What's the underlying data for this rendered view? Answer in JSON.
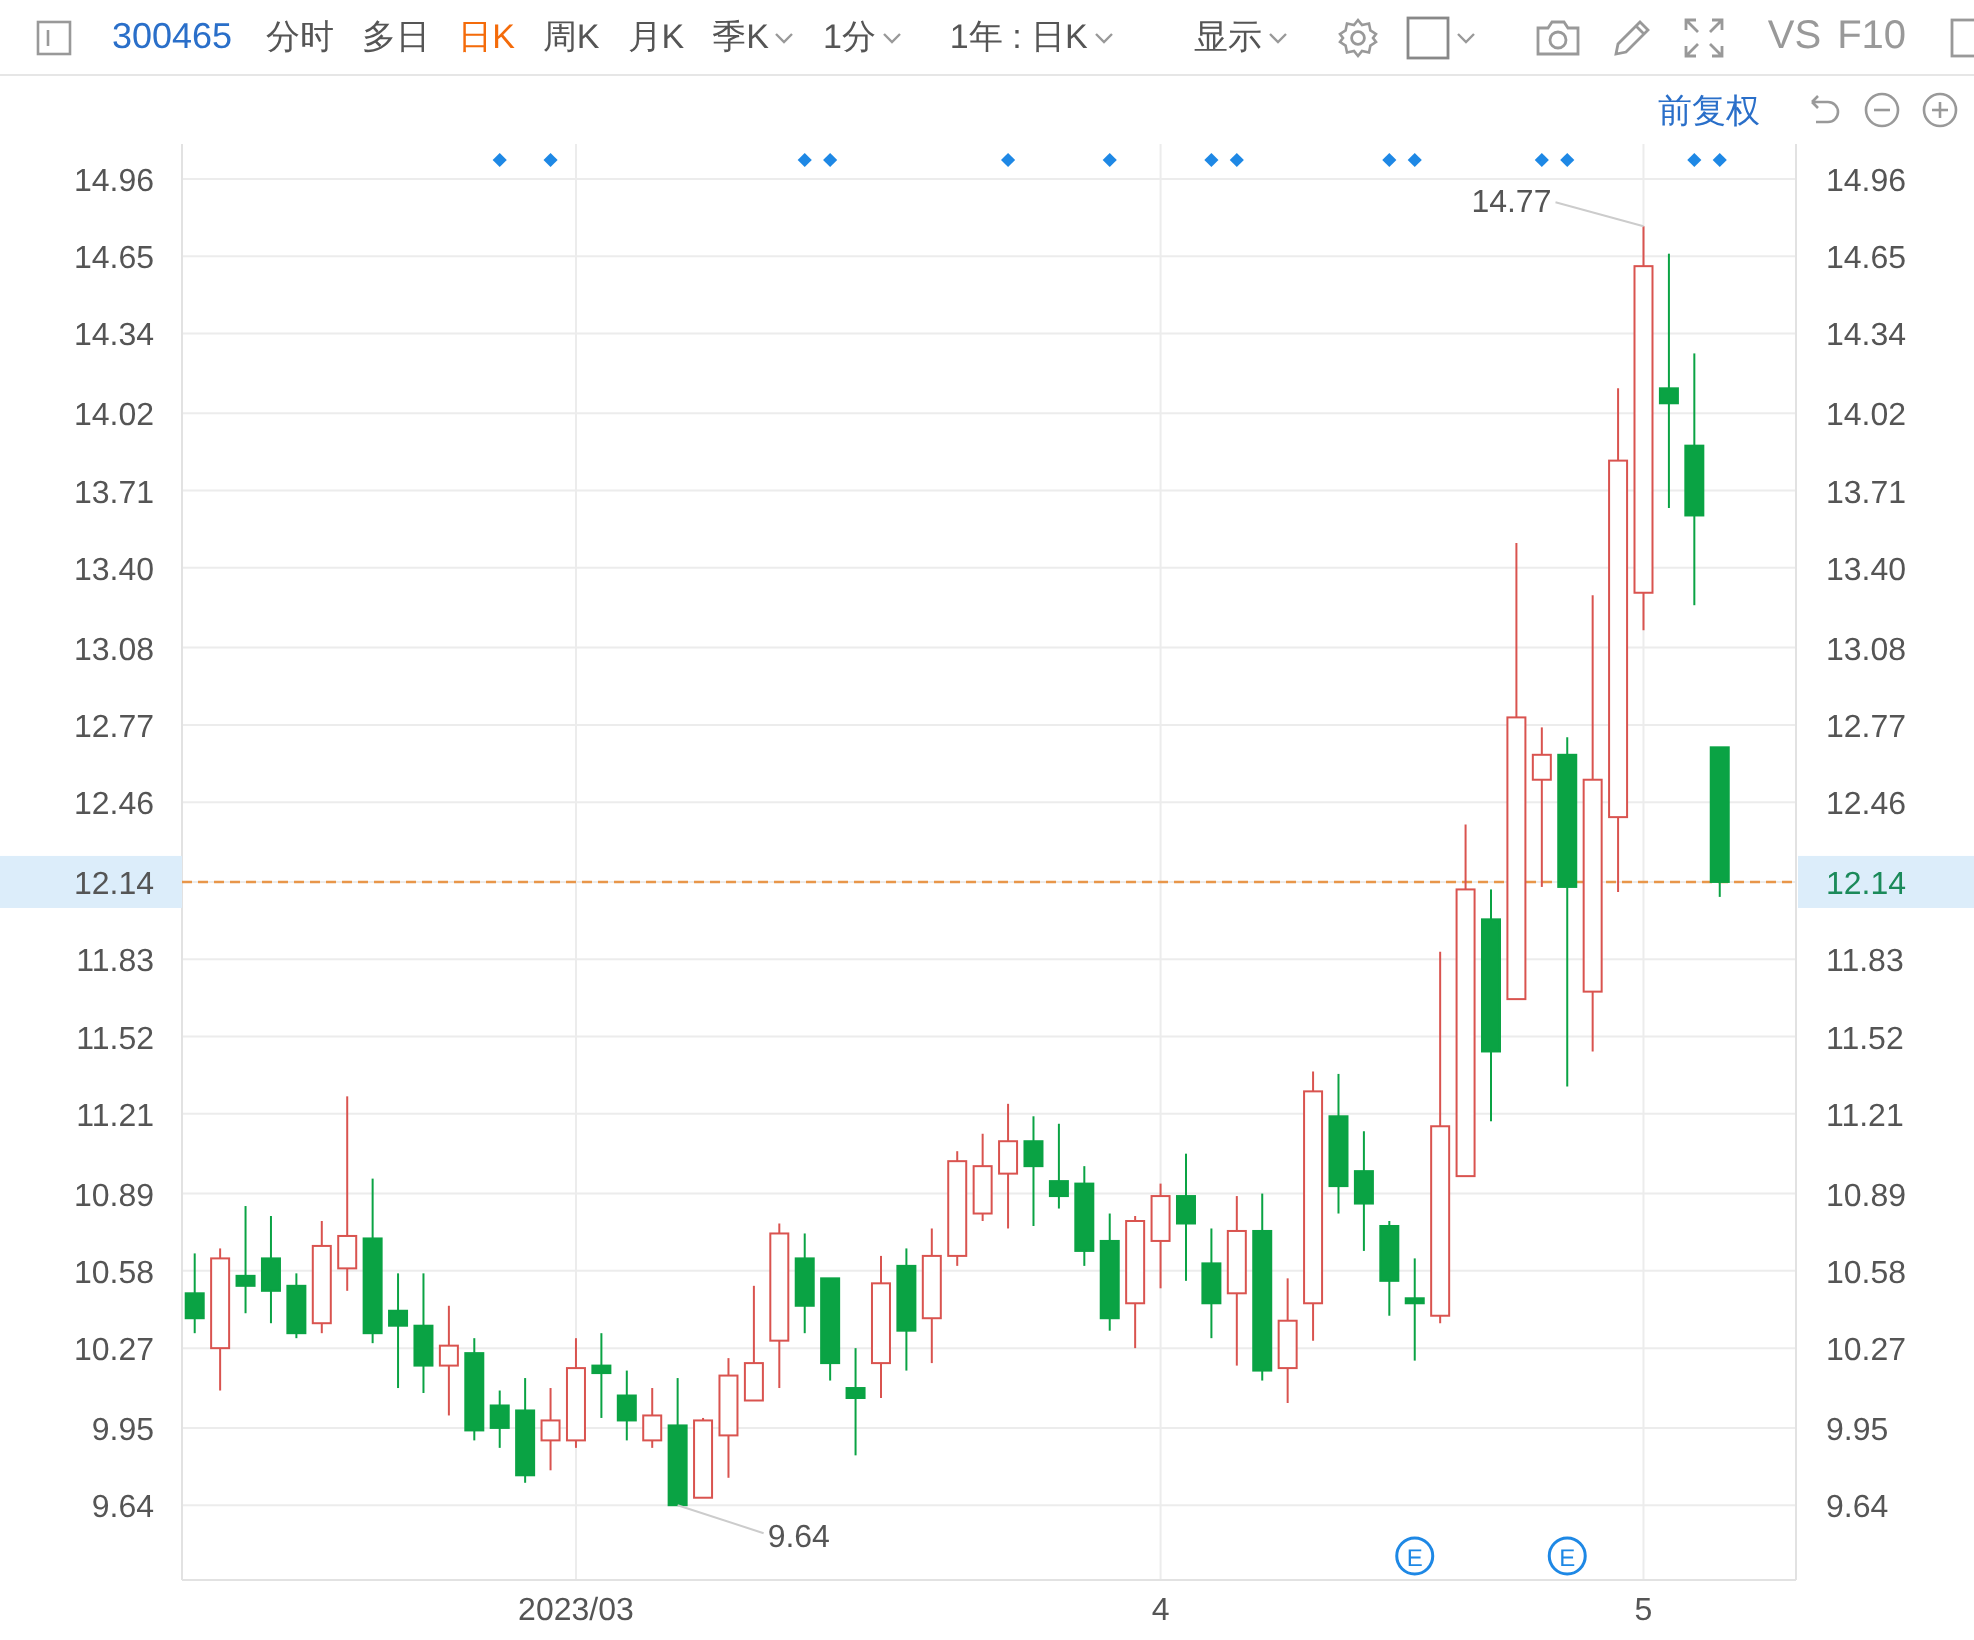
{
  "toolbar": {
    "symbol": "300465",
    "period_tabs": [
      {
        "label": "分时",
        "selected": false,
        "dropdown": false
      },
      {
        "label": "多日",
        "selected": false,
        "dropdown": false
      },
      {
        "label": "日K",
        "selected": true,
        "dropdown": false
      },
      {
        "label": "周K",
        "selected": false,
        "dropdown": false
      },
      {
        "label": "月K",
        "selected": false,
        "dropdown": false
      },
      {
        "label": "季K",
        "selected": false,
        "dropdown": true
      }
    ],
    "interval_select": "1分",
    "range_select": "1年 : 日K",
    "display_menu": "显示",
    "compare_button": "VS",
    "f10_button": "F10"
  },
  "chart_header": {
    "adjust_mode": "前复权"
  },
  "chart": {
    "chart_data": {
      "type": "candlestick",
      "grid": true,
      "categories": [
        null,
        null,
        null,
        null,
        null,
        null,
        null,
        null,
        null,
        null,
        null,
        null,
        null,
        null,
        null,
        "2023/03",
        null,
        null,
        null,
        null,
        null,
        null,
        null,
        null,
        null,
        null,
        null,
        null,
        null,
        null,
        null,
        null,
        null,
        null,
        null,
        null,
        null,
        null,
        "4",
        null,
        null,
        null,
        null,
        null,
        null,
        null,
        null,
        null,
        null,
        null,
        null,
        null,
        null,
        null,
        null,
        null,
        null,
        "5",
        null,
        null,
        null
      ],
      "ylim": [
        9.34,
        15.1
      ],
      "yticks": [
        14.96,
        14.65,
        14.34,
        14.02,
        13.71,
        {
          "value": 13.4,
          "label": "13.40"
        },
        13.08,
        12.77,
        12.46,
        12.14,
        11.83,
        11.52,
        11.21,
        10.89,
        10.58,
        10.27,
        9.95,
        9.64
      ],
      "ohlc": [
        [
          10.49,
          10.65,
          10.33,
          10.39
        ],
        [
          10.27,
          10.67,
          10.1,
          10.63
        ],
        [
          10.56,
          10.84,
          10.41,
          10.52
        ],
        [
          10.63,
          10.8,
          10.37,
          10.5
        ],
        [
          10.52,
          10.57,
          10.31,
          10.33
        ],
        [
          10.37,
          10.78,
          10.33,
          10.68
        ],
        [
          10.59,
          11.28,
          10.5,
          10.72
        ],
        [
          10.71,
          10.95,
          10.29,
          10.33
        ],
        [
          10.42,
          10.57,
          10.11,
          10.36
        ],
        [
          10.36,
          10.57,
          10.09,
          10.2
        ],
        [
          10.2,
          10.44,
          10.0,
          10.28
        ],
        [
          10.25,
          10.31,
          9.9,
          9.94
        ],
        [
          10.04,
          10.1,
          9.87,
          9.95
        ],
        [
          10.02,
          10.15,
          9.73,
          9.76
        ],
        [
          9.9,
          10.11,
          9.78,
          9.98
        ],
        [
          9.9,
          10.31,
          9.87,
          10.19
        ],
        [
          10.2,
          10.33,
          9.99,
          10.17
        ],
        [
          10.08,
          10.18,
          9.9,
          9.98
        ],
        [
          9.9,
          10.11,
          9.87,
          10.0
        ],
        [
          9.96,
          10.15,
          9.64,
          9.64
        ],
        [
          9.67,
          9.99,
          9.67,
          9.98
        ],
        [
          9.92,
          10.23,
          9.75,
          10.16
        ],
        [
          10.06,
          10.52,
          10.06,
          10.21
        ],
        [
          10.3,
          10.77,
          10.11,
          10.73
        ],
        [
          10.63,
          10.73,
          10.33,
          10.44
        ],
        [
          10.55,
          10.55,
          10.14,
          10.21
        ],
        [
          10.11,
          10.27,
          9.84,
          10.07
        ],
        [
          10.21,
          10.64,
          10.07,
          10.53
        ],
        [
          10.6,
          10.67,
          10.18,
          10.34
        ],
        [
          10.39,
          10.75,
          10.21,
          10.64
        ],
        [
          10.64,
          11.06,
          10.6,
          11.02
        ],
        [
          10.81,
          11.13,
          10.78,
          11.0
        ],
        [
          10.97,
          11.25,
          10.75,
          11.1
        ],
        [
          11.1,
          11.2,
          10.76,
          11.0
        ],
        [
          10.94,
          11.17,
          10.83,
          10.88
        ],
        [
          10.93,
          11.0,
          10.6,
          10.66
        ],
        [
          10.7,
          10.81,
          10.34,
          10.39
        ],
        [
          10.45,
          10.8,
          10.27,
          10.78
        ],
        [
          10.7,
          10.93,
          10.51,
          10.88
        ],
        [
          10.88,
          11.05,
          10.54,
          10.77
        ],
        [
          10.61,
          10.75,
          10.31,
          10.45
        ],
        [
          10.49,
          10.88,
          10.2,
          10.74
        ],
        [
          10.74,
          10.89,
          10.14,
          10.18
        ],
        [
          10.19,
          10.55,
          10.05,
          10.38
        ],
        [
          10.45,
          11.38,
          10.3,
          11.3
        ],
        [
          11.2,
          11.37,
          10.81,
          10.92
        ],
        [
          10.98,
          11.14,
          10.66,
          10.85
        ],
        [
          10.76,
          10.78,
          10.4,
          10.54
        ],
        [
          10.47,
          10.63,
          10.22,
          10.45
        ],
        [
          10.4,
          11.86,
          10.37,
          11.16
        ],
        [
          10.96,
          12.37,
          10.96,
          12.11
        ],
        [
          11.99,
          12.11,
          11.18,
          11.46
        ],
        [
          11.67,
          13.5,
          11.67,
          12.8
        ],
        [
          12.55,
          12.76,
          12.12,
          12.65
        ],
        [
          12.65,
          12.72,
          11.32,
          12.12
        ],
        [
          11.7,
          13.29,
          11.46,
          12.55
        ],
        [
          12.4,
          14.12,
          12.1,
          13.83
        ],
        [
          13.3,
          14.77,
          13.15,
          14.61
        ],
        [
          14.12,
          14.66,
          13.64,
          14.06
        ],
        [
          13.89,
          14.26,
          13.25,
          13.61
        ],
        [
          12.68,
          12.68,
          12.08,
          12.14
        ]
      ],
      "ref_lines": [
        {
          "axis": "y",
          "value": 12.14
        }
      ],
      "annotations": [
        "14.77",
        "9.64"
      ]
    },
    "right_axis_labels": [
      "14.96",
      "14.65",
      "14.34",
      "14.02",
      "13.71",
      "13.40",
      "13.08",
      "12.77",
      "12.46",
      "12.14",
      "11.83",
      "11.52",
      "11.21",
      "10.89",
      "10.58",
      "10.27",
      "9.95",
      "9.64"
    ],
    "candle_marks": [
      {
        "signal": false
      },
      {
        "signal": false
      },
      {
        "signal": false
      },
      {
        "signal": false
      },
      {
        "signal": false
      },
      {
        "signal": false
      },
      {
        "signal": false
      },
      {
        "signal": false
      },
      {
        "signal": false
      },
      {
        "signal": false
      },
      {
        "signal": false
      },
      {
        "signal": false
      },
      {
        "signal": true
      },
      {
        "signal": false
      },
      {
        "signal": true
      },
      {
        "signal": false
      },
      {
        "signal": false
      },
      {
        "signal": false
      },
      {
        "signal": false
      },
      {
        "signal": false
      },
      {
        "signal": false
      },
      {
        "signal": false
      },
      {
        "signal": false
      },
      {
        "signal": false
      },
      {
        "signal": true
      },
      {
        "signal": true
      },
      {
        "signal": false
      },
      {
        "signal": false
      },
      {
        "signal": false
      },
      {
        "signal": false
      },
      {
        "signal": false
      },
      {
        "signal": false
      },
      {
        "signal": true
      },
      {
        "signal": false
      },
      {
        "signal": false
      },
      {
        "signal": false
      },
      {
        "signal": true
      },
      {
        "signal": false
      },
      {
        "signal": false
      },
      {
        "signal": false
      },
      {
        "signal": true
      },
      {
        "signal": true
      },
      {
        "signal": false
      },
      {
        "signal": false
      },
      {
        "signal": false
      },
      {
        "signal": false
      },
      {
        "signal": false
      },
      {
        "signal": true
      },
      {
        "signal": true,
        "badge": "E"
      },
      {
        "signal": false
      },
      {
        "signal": false
      },
      {
        "signal": false
      },
      {
        "signal": false
      },
      {
        "signal": true
      },
      {
        "signal": true,
        "badge": "E"
      },
      {
        "signal": false
      },
      {
        "signal": false
      },
      {
        "signal": false
      },
      {
        "signal": false
      },
      {
        "signal": true
      },
      {
        "signal": true
      }
    ]
  }
}
